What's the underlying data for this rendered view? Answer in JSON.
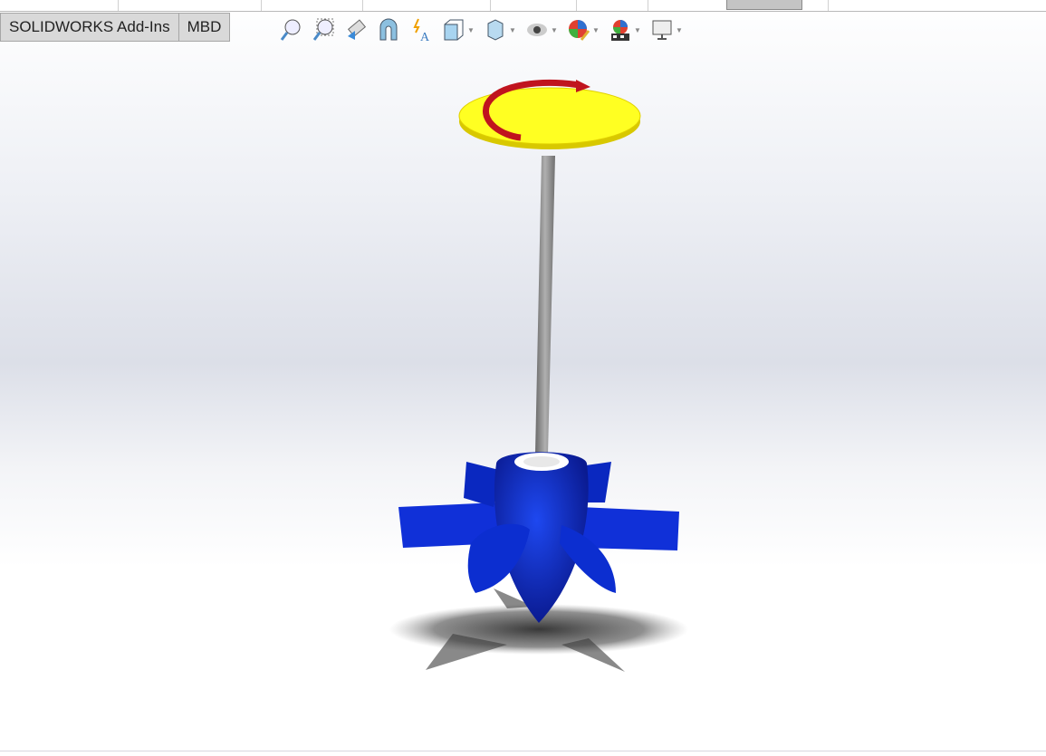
{
  "tabs": [
    {
      "label": "SOLIDWORKS Add-Ins"
    },
    {
      "label": "MBD"
    }
  ],
  "toolbar": {
    "icons": [
      "zoom-to-fit-icon",
      "zoom-to-area-icon",
      "previous-view-icon",
      "section-view-icon",
      "dynamic-annotation-view-icon",
      "view-orientation-icon",
      "display-style-icon",
      "hide-show-items-icon",
      "edit-appearance-icon",
      "apply-scene-icon",
      "view-settings-icon"
    ]
  },
  "colors": {
    "disc": "#ffff22",
    "arrow": "#c0141e",
    "shaft": "#8a8a8a",
    "impeller": "#0a2fd0"
  }
}
